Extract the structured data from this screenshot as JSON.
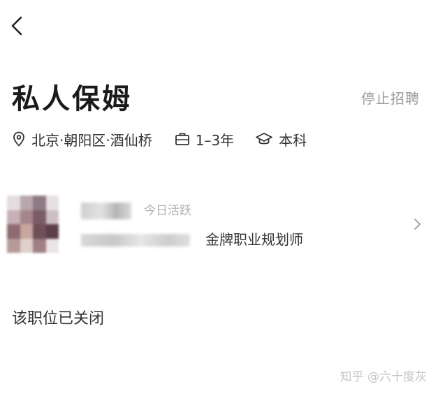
{
  "job": {
    "title": "私人保姆",
    "status_action": "停止招聘",
    "location": "北京·朝阳区·酒仙桥",
    "experience": "1–3年",
    "education": "本科"
  },
  "icons": {
    "back": "chevron-left-icon",
    "location": "location-pin-icon",
    "experience": "briefcase-icon",
    "education": "graduation-cap-icon",
    "card_arrow": "chevron-right-icon"
  },
  "recruiter": {
    "active_status": "今日活跃",
    "role_title": "金牌职业规划师"
  },
  "notice": {
    "closed": "该职位已关闭"
  },
  "watermark": {
    "text": "知乎 @六十度灰"
  },
  "colors": {
    "primary_text": "#1a1a1a",
    "secondary_text": "#9a9a9a",
    "background": "#ffffff"
  }
}
